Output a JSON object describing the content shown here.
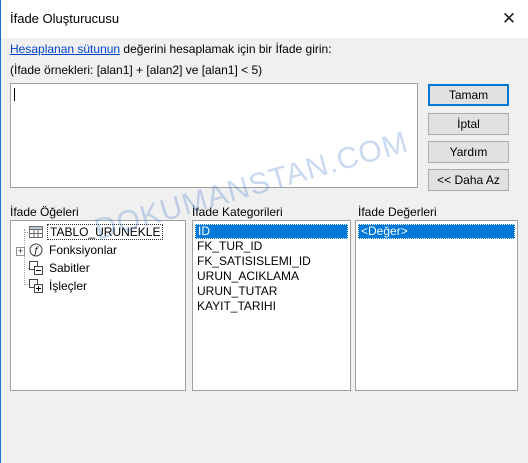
{
  "window": {
    "title": "İfade Oluşturucusu",
    "close_symbol": "✕"
  },
  "instructions": {
    "link_text": "Hesaplanan sütunun",
    "rest_text": " değerini hesaplamak için bir İfade girin:",
    "examples": "(İfade örnekleri: [alan1] + [alan2] ve [alan1] < 5)"
  },
  "expression": {
    "value": ""
  },
  "buttons": {
    "ok": "Tamam",
    "cancel": "İptal",
    "help": "Yardım",
    "less": "<< Daha Az"
  },
  "elements": {
    "label": "İfade Öğeleri",
    "items": [
      {
        "label": "TABLO_URUNEKLE",
        "icon": "table-icon",
        "selected": true
      },
      {
        "label": "Fonksiyonlar",
        "icon": "function-icon",
        "expandable": true
      },
      {
        "label": "Sabitler",
        "icon": "constants-icon"
      },
      {
        "label": "İşleçler",
        "icon": "operators-icon"
      }
    ]
  },
  "categories": {
    "label": "İfade Kategorileri",
    "items": [
      "ID",
      "FK_TUR_ID",
      "FK_SATISISLEMI_ID",
      "URUN_ACIKLAMA",
      "URUN_TUTAR",
      "KAYIT_TARIHI"
    ],
    "selected_index": 0
  },
  "values": {
    "label": "İfade Değerleri",
    "items": [
      "<Değer>"
    ],
    "selected_index": 0
  },
  "watermark": {
    "text": "DOKUMANSTAN.COM"
  },
  "colors": {
    "selection": "#0078d7",
    "link": "#0044cc",
    "dialog_bg": "#f0f0f0"
  }
}
